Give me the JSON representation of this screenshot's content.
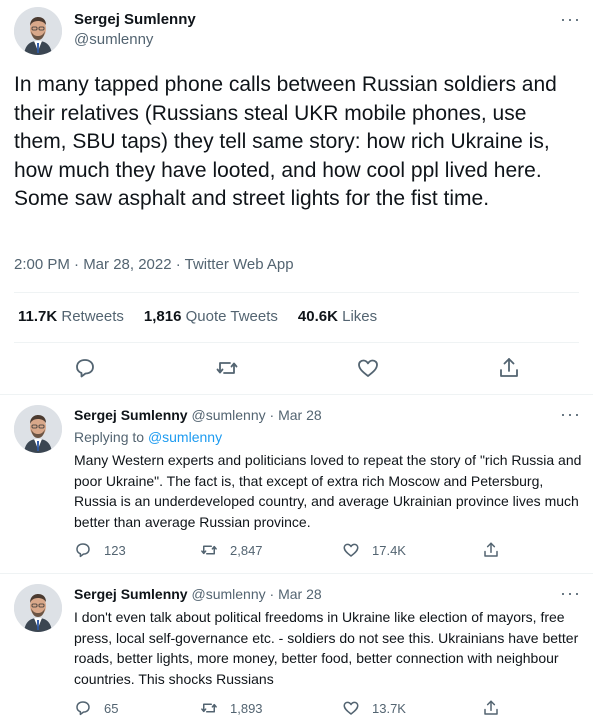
{
  "main_tweet": {
    "author_name": "Sergej Sumlenny",
    "author_handle": "@sumlenny",
    "more_label": "···",
    "text": "In many tapped phone calls between Russian soldiers and their relatives (Russians steal UKR mobile phones, use them, SBU taps) they tell same story: how rich Ukraine is, how much they have looted, and how cool ppl lived here. Some saw asphalt and street lights for the fist time.",
    "meta": "2:00 PM · Mar 28, 2022 · Twitter Web App",
    "stats": [
      {
        "value": "11.7K",
        "label": "Retweets"
      },
      {
        "value": "1,816",
        "label": "Quote Tweets"
      },
      {
        "value": "40.6K",
        "label": "Likes"
      }
    ],
    "actions": [
      "reply-icon",
      "retweet-icon",
      "like-icon",
      "share-icon"
    ]
  },
  "replies": [
    {
      "author_name": "Sergej Sumlenny",
      "author_handle": "@sumlenny",
      "date": "· Mar 28",
      "more_label": "···",
      "replying_prefix": "Replying to ",
      "replying_handle": "@sumlenny",
      "text": "Many Western experts and politicians loved to repeat the story of \"rich Russia and poor Ukraine\". The fact is, that except of extra rich Moscow and Petersburg, Russia is an underdeveloped country, and average Ukrainian province lives much better than average Russian province.",
      "counts": {
        "replies": "123",
        "retweets": "2,847",
        "likes": "17.4K"
      }
    },
    {
      "author_name": "Sergej Sumlenny",
      "author_handle": "@sumlenny",
      "date": "· Mar 28",
      "more_label": "···",
      "text": "I don't even talk about political freedoms in Ukraine like election of mayors, free press, local self-governance etc. - soldiers do not see this. Ukrainians have better roads, better lights, more money, better food, better connection with neighbour countries. This shocks Russians",
      "counts": {
        "replies": "65",
        "retweets": "1,893",
        "likes": "13.7K"
      }
    }
  ],
  "colors": {
    "text": "#0f1419",
    "muted": "#536471",
    "link": "#1d9bf0",
    "divider": "#eff3f4"
  }
}
